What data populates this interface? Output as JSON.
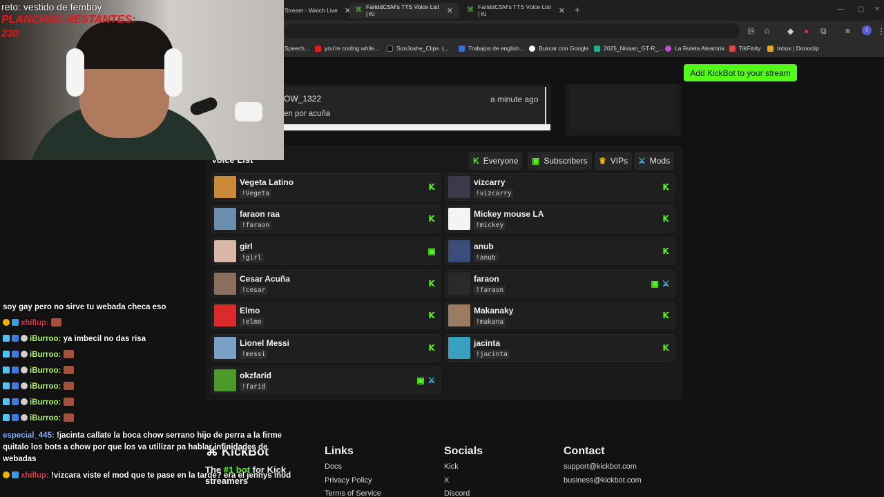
{
  "browser": {
    "tabs": [
      {
        "label": "Stream - Watch Live",
        "active": false
      },
      {
        "label": "FariddCSM's TTS Voice List | Ki",
        "active": true
      },
      {
        "label": "FariddCSM's TTS Voice List | Ki",
        "active": false
      }
    ],
    "new_tab": "+",
    "bookmarks": [
      {
        "label": "Speech..."
      },
      {
        "label": "you're coding while..."
      },
      {
        "label": "SonJoshe_Clips"
      },
      {
        "label": "(..."
      },
      {
        "label": "Trabajos de english..."
      },
      {
        "label": "Buscar con Google"
      },
      {
        "label": "2025_Nissan_GT-R_..."
      },
      {
        "label": "La Ruleta Aleatoria"
      },
      {
        "label": "TikFinity"
      },
      {
        "label": "Inbox | Donoclip"
      }
    ],
    "profile_initial": "I"
  },
  "header": {
    "cta_label": "Add KickBot to your stream"
  },
  "latest_message": {
    "user": "OW_1322",
    "time": "a minute ago",
    "text": "en por acuña"
  },
  "voice_list": {
    "title": "Voice List",
    "filters": [
      {
        "label": "Everyone",
        "icon": "K"
      },
      {
        "label": "Subscribers",
        "icon": "gift"
      },
      {
        "label": "VIPs",
        "icon": "crown"
      },
      {
        "label": "Mods",
        "icon": "sword"
      }
    ],
    "voices": [
      {
        "name": "Vegeta Latino",
        "cmd": "!Vegeta",
        "badges": [
          "K"
        ],
        "avatar": "#c98a3a"
      },
      {
        "name": "vizcarry",
        "cmd": "!vizcarry",
        "badges": [
          "K"
        ],
        "avatar": "#3a3a4a"
      },
      {
        "name": "faraon raa",
        "cmd": "!faraon",
        "badges": [
          "K"
        ],
        "avatar": "#6a8db0"
      },
      {
        "name": "Mickey mouse LA",
        "cmd": "!mickey",
        "badges": [
          "K"
        ],
        "avatar": "#f4f4f4"
      },
      {
        "name": "girl",
        "cmd": "!girl",
        "badges": [
          "gift"
        ],
        "avatar": "#d9b7a6"
      },
      {
        "name": "anub",
        "cmd": "!anub",
        "badges": [
          "K"
        ],
        "avatar": "#3b4d7a"
      },
      {
        "name": "Cesar Acuña",
        "cmd": "!cesar",
        "badges": [
          "K"
        ],
        "avatar": "#8a6f5e"
      },
      {
        "name": "faraon",
        "cmd": "!faraon",
        "badges": [
          "gift",
          "sword"
        ],
        "avatar": "#2a2a2a"
      },
      {
        "name": "Elmo",
        "cmd": "!elmo",
        "badges": [
          "K"
        ],
        "avatar": "#d92b2b"
      },
      {
        "name": "Makanaky",
        "cmd": "!makana",
        "badges": [
          "K"
        ],
        "avatar": "#9b7b62"
      },
      {
        "name": "Lionel Messi",
        "cmd": "!messi",
        "badges": [
          "K"
        ],
        "avatar": "#7aa0c4"
      },
      {
        "name": "jacinta",
        "cmd": "!jacinta",
        "badges": [
          "K"
        ],
        "avatar": "#3aa0c0"
      },
      {
        "name": "okzfarid",
        "cmd": "!farid",
        "badges": [
          "gift",
          "sword"
        ],
        "avatar": "#4c9a2a"
      }
    ]
  },
  "footer": {
    "logo": "KickBot",
    "tagline_pre": "The ",
    "tagline_hl": "#1 bot",
    "tagline_post": " for Kick streamers",
    "links": {
      "title": "Links",
      "items": [
        "Docs",
        "Privacy Policy",
        "Terms of Service"
      ]
    },
    "socials": {
      "title": "Socials",
      "items": [
        "Kick",
        "X",
        "Discord"
      ]
    },
    "contact": {
      "title": "Contact",
      "items": [
        "support@kickbot.com",
        "business@kickbot.com"
      ]
    }
  },
  "overlay": {
    "reto": "reto:  vestido de femboy",
    "planchas_label": "PLANCHAS RESTANTES:",
    "planchas_value": "230",
    "chat": [
      {
        "user": "",
        "text": "soy gay pero no sirve tu webada checa eso",
        "color": "white"
      },
      {
        "user": "xhillup:",
        "text": "",
        "color": "red",
        "emote": true
      },
      {
        "user": "iBurroo:",
        "text": "ya imbecil no das risa",
        "color": "green"
      },
      {
        "user": "iBurroo:",
        "text": "",
        "color": "green",
        "emote": true
      },
      {
        "user": "iBurroo:",
        "text": "",
        "color": "green",
        "emote": true
      },
      {
        "user": "iBurroo:",
        "text": "",
        "color": "green",
        "emote": true
      },
      {
        "user": "iBurroo:",
        "text": "",
        "color": "green",
        "emote": true
      },
      {
        "user": "iBurroo:",
        "text": "",
        "color": "green",
        "emote": true
      },
      {
        "user": "especial_445:",
        "text": "!jacinta callate la boca chow serrano hijo de perra a la firme quitalo los bots a chow por que los va utilizar pa hablar infinidades de webadas",
        "color": "blue"
      },
      {
        "user": "xhillup:",
        "text": "!vizcara viste el mod que te pase en la tarde? era el jennys mod",
        "color": "red"
      }
    ]
  }
}
